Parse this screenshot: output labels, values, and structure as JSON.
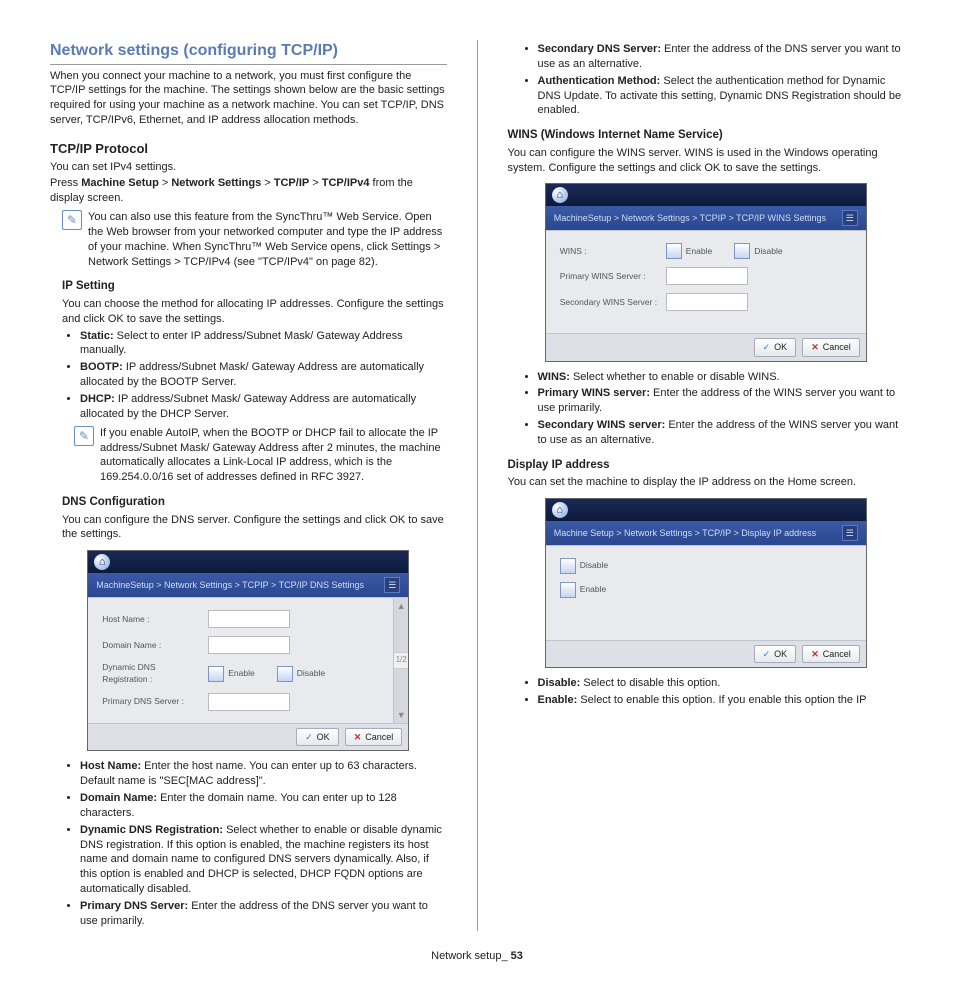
{
  "title": "Network settings (configuring TCP/IP)",
  "intro": "When you connect your machine to a network, you must first configure the TCP/IP settings for the machine. The settings shown below are the basic settings required for using your machine as a network machine. You can set TCP/IP, DNS server, TCP/IPv6, Ethernet, and IP address allocation methods.",
  "tcpip": {
    "heading": "TCP/IP Protocol",
    "p1": "You can set IPv4 settings.",
    "p2a": "Press ",
    "p2_path": [
      "Machine Setup",
      "Network Settings",
      "TCP/IP",
      "TCP/IPv4"
    ],
    "p2b": " from the display screen.",
    "note1": "You can also use this feature from the SyncThru™ Web Service. Open the Web browser from your networked computer and type the IP address of your machine. When SyncThru™ Web Service opens, click Settings > Network Settings > TCP/IPv4 (see \"TCP/IPv4\" on page 82)."
  },
  "ip": {
    "heading": "IP Setting",
    "p1": "You can choose the method for allocating IP addresses. Configure the settings and click OK to save the settings.",
    "items": [
      {
        "label": "Static:",
        "text": "  Select to enter IP address/Subnet Mask/ Gateway Address manually."
      },
      {
        "label": "BOOTP:",
        "text": "  IP address/Subnet Mask/ Gateway Address are automatically allocated by the BOOTP Server."
      },
      {
        "label": "DHCP:",
        "text": "  IP address/Subnet Mask/ Gateway Address are automatically allocated by the DHCP Server."
      }
    ],
    "note": "If you enable AutoIP, when the BOOTP or DHCP fail to allocate the IP address/Subnet Mask/ Gateway Address after 2 minutes, the machine automatically allocates a Link-Local IP address, which is the 169.254.0.0/16 set of addresses defined in RFC 3927."
  },
  "dns": {
    "heading": "DNS Configuration",
    "p1": "You can configure the DNS server. Configure the settings and click OK to save the settings.",
    "panel": {
      "breadcrumb": "MachineSetup > Network Settings > TCPIP > TCP/IP DNS Settings",
      "rows": {
        "host": "Host Name :",
        "domain": "Domain Name :",
        "ddns": "Dynamic DNS Registration :",
        "enable": "Enable",
        "disable": "Disable",
        "primary": "Primary DNS Server :"
      },
      "page": "1/2",
      "ok": "OK",
      "cancel": "Cancel"
    },
    "items": [
      {
        "label": "Host Name:",
        "text": "  Enter the host name. You can enter up to 63 characters. Default name is \"SEC[MAC address]\"."
      },
      {
        "label": "Domain Name:",
        "text": "  Enter the domain name. You can enter up to 128 characters."
      },
      {
        "label": "Dynamic DNS Registration:",
        "text": "  Select whether to enable or disable dynamic DNS registration. If this option is enabled, the machine registers its host name and domain name to configured DNS servers dynamically. Also, if this option is enabled and DHCP is selected, DHCP FQDN options are automatically disabled."
      },
      {
        "label": "Primary DNS Server:",
        "text": "  Enter the address of the DNS server you want to use primarily."
      }
    ]
  },
  "col2top": [
    {
      "label": "Secondary DNS Server:",
      "text": "  Enter the address of the DNS server you want to use as an alternative."
    },
    {
      "label": "Authentication Method:",
      "text": "  Select the authentication method for Dynamic DNS Update. To activate this setting, Dynamic DNS Registration should be enabled."
    }
  ],
  "wins": {
    "heading": "WINS (Windows Internet Name Service)",
    "p1": "You can configure the WINS server. WINS is used in the Windows operating system. Configure the settings and click OK to save the settings.",
    "panel": {
      "breadcrumb": "MachineSetup > Network Settings > TCPIP > TCP/IP WINS Settings",
      "rows": {
        "wins": "WINS :",
        "enable": "Enable",
        "disable": "Disable",
        "primary": "Primary WINS Server :",
        "secondary": "Secondary WINS Server :"
      },
      "ok": "OK",
      "cancel": "Cancel"
    },
    "items": [
      {
        "label": "WINS:",
        "text": "  Select whether to enable or disable WINS."
      },
      {
        "label": "Primary WINS server:",
        "text": "  Enter the address of the WINS server you want to use primarily."
      },
      {
        "label": "Secondary WINS server:",
        "text": "  Enter the address of the WINS server you want to use as an alternative."
      }
    ]
  },
  "display_ip": {
    "heading": "Display IP address",
    "p1": "You can set the machine to display the IP address on the Home screen.",
    "panel": {
      "breadcrumb": "Machine Setup > Network Settings > TCP/IP > Display IP address",
      "disable": "Disable",
      "enable": "Enable",
      "ok": "OK",
      "cancel": "Cancel"
    },
    "items": [
      {
        "label": "Disable:",
        "text": "  Select to disable this option."
      },
      {
        "label": "Enable:",
        "text": "  Select to enable this option. If you enable this option the IP"
      }
    ]
  },
  "footer": {
    "section": "Network setup",
    "sep": "_ ",
    "page": "53"
  }
}
